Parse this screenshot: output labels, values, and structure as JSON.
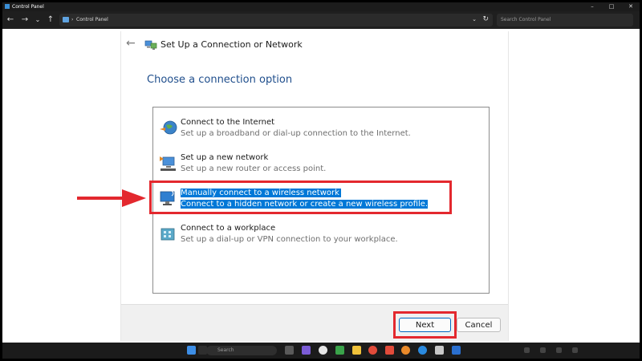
{
  "window": {
    "title": "Control Panel",
    "buttons": [
      "–",
      "□",
      "✕"
    ]
  },
  "address": {
    "location": "Control Panel",
    "separator": "›",
    "search_placeholder": "Search Control Panel"
  },
  "dialog": {
    "title": "Set Up a Connection or Network",
    "heading": "Choose a connection option",
    "options": [
      {
        "title": "Connect to the Internet",
        "description": "Set up a broadband or dial-up connection to the Internet.",
        "icon": "globe-icon"
      },
      {
        "title": "Set up a new network",
        "description": "Set up a new router or access point.",
        "icon": "router-icon"
      },
      {
        "title": "Manually connect to a wireless network",
        "description": "Connect to a hidden network or create a new wireless profile.",
        "icon": "wireless-monitor-icon",
        "selected": true
      },
      {
        "title": "Connect to a workplace",
        "description": "Set up a dial-up or VPN connection to your workplace.",
        "icon": "workplace-icon"
      }
    ],
    "next_label": "Next",
    "cancel_label": "Cancel"
  },
  "taskbar": {
    "search_label": "Search",
    "icons": [
      "start-icon",
      "search-icon",
      "task-view-icon",
      "chat-icon",
      "explorer-icon",
      "chrome-icon",
      "edge-icon",
      "store-icon"
    ]
  },
  "colors": {
    "highlight": "#0078d7",
    "annotation": "#e3282e",
    "heading": "#1f4e8c"
  }
}
